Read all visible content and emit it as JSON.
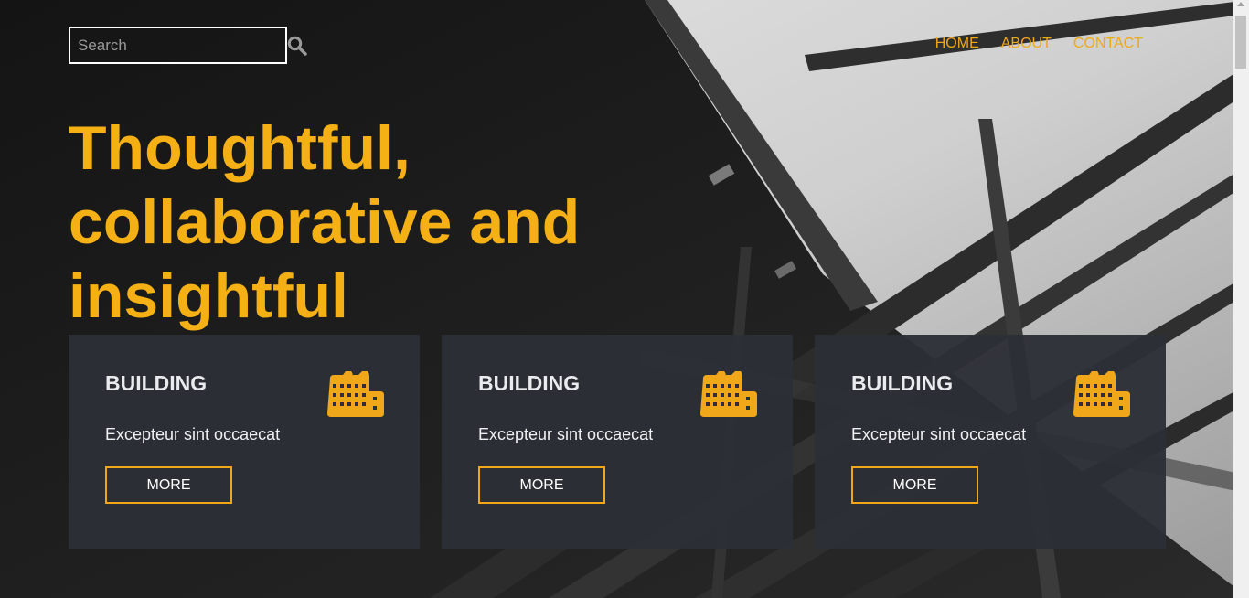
{
  "search": {
    "placeholder": "Search",
    "icon": "search-icon"
  },
  "nav": {
    "items": [
      {
        "label": "HOME"
      },
      {
        "label": "ABOUT"
      },
      {
        "label": "CONTACT"
      }
    ]
  },
  "hero": {
    "title": "Thoughtful, collaborative and insightful"
  },
  "cards": [
    {
      "title": "BUILDING",
      "text": "Excepteur sint occaecat",
      "button": "MORE",
      "icon": "factory-icon"
    },
    {
      "title": "BUILDING",
      "text": "Excepteur sint occaecat",
      "button": "MORE",
      "icon": "factory-icon"
    },
    {
      "title": "BUILDING",
      "text": "Excepteur sint occaecat",
      "button": "MORE",
      "icon": "factory-icon"
    }
  ],
  "colors": {
    "accent": "#f5b015",
    "nav": "#eea81a",
    "card_bg": "#2c2f35"
  }
}
